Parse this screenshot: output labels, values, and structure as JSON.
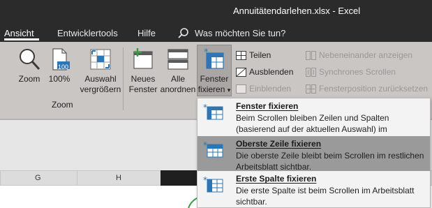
{
  "window": {
    "title": "Annuitätendarlehen.xlsx  -  Excel"
  },
  "tabs": [
    {
      "label": "Ansicht",
      "active": true
    },
    {
      "label": "Entwicklertools"
    },
    {
      "label": "Hilfe"
    }
  ],
  "search": {
    "placeholder": "Was möchten Sie tun?",
    "icon": "search-icon"
  },
  "zoom_group": {
    "label": "Zoom",
    "zoom": "Zoom",
    "hundred_line1": "100%",
    "hundred_badge": "100",
    "selection_line1": "Auswahl",
    "selection_line2": "vergrößern"
  },
  "window_group": {
    "new_window_line1": "Neues",
    "new_window_line2": "Fenster",
    "arrange_line1": "Alle",
    "arrange_line2": "anordnen",
    "freeze_line1": "Fenster",
    "freeze_line2": "fixieren",
    "freeze_caret": "▾",
    "split": "Teilen",
    "hide": "Ausblenden",
    "unhide": "Einblenden",
    "side_by_side": "Nebeneinander anzeigen",
    "sync_scroll": "Synchrones Scrollen",
    "reset_position": "Fensterposition zurücksetzen"
  },
  "columns": [
    "G",
    "H"
  ],
  "menu": {
    "items": [
      {
        "title": "Fenster fixieren",
        "desc": "Beim Scrollen bleiben Zeilen und Spalten (basierend auf der aktuellen Auswahl) im Arbeitsblatt sichtbar."
      },
      {
        "title": "Oberste Zeile fixieren",
        "desc": "Die oberste Zeile bleibt beim Scrollen im restlichen Arbeitsblatt sichtbar."
      },
      {
        "title": "Erste Spalte fixieren",
        "desc": "Die erste Spalte ist beim Scrollen im Arbeitsblatt sichtbar."
      }
    ],
    "highlighted_index": 1
  },
  "colors": {
    "titlebar": "#2b2b2b",
    "ribbon": "#c9c6c3",
    "menu_highlight": "#9a9a9a",
    "accent_green": "#3a9a4a",
    "freeze_icon_blue": "#2e75b6"
  }
}
